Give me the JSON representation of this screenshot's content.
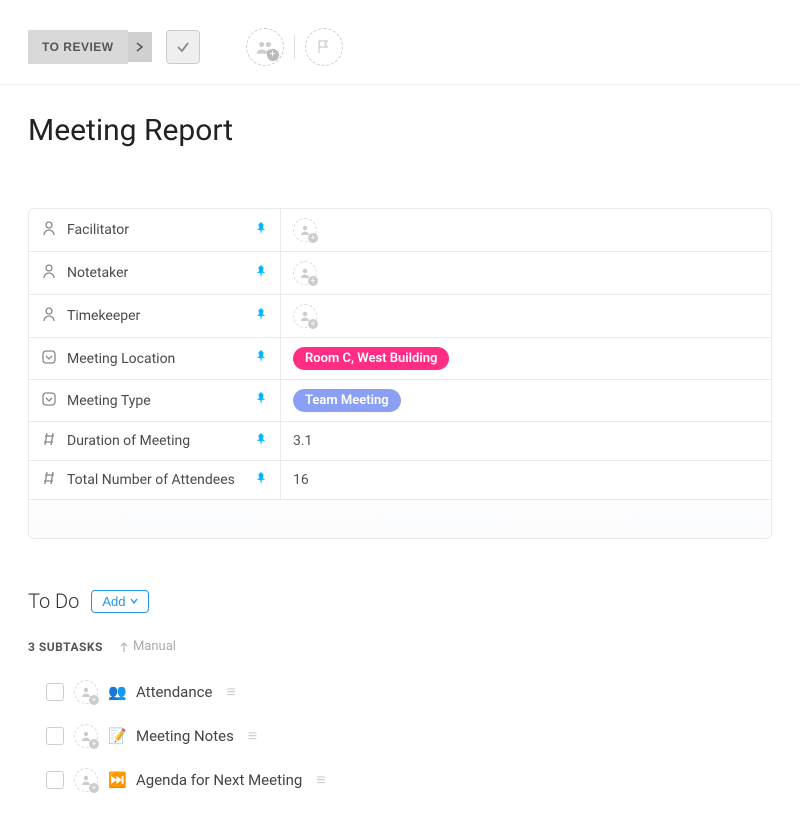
{
  "toolbar": {
    "status_label": "TO REVIEW"
  },
  "title": "Meeting Report",
  "fields": [
    {
      "icon": "person",
      "label": "Facilitator",
      "value_type": "assignee"
    },
    {
      "icon": "person",
      "label": "Notetaker",
      "value_type": "assignee"
    },
    {
      "icon": "person",
      "label": "Timekeeper",
      "value_type": "assignee"
    },
    {
      "icon": "dropdown",
      "label": "Meeting Location",
      "value_type": "pill",
      "pill_color": "pill-pink",
      "value": "Room C, West Building"
    },
    {
      "icon": "dropdown",
      "label": "Meeting Type",
      "value_type": "pill",
      "pill_color": "pill-lilac",
      "value": "Team Meeting"
    },
    {
      "icon": "number",
      "label": "Duration of Meeting",
      "value_type": "text",
      "value": "3.1"
    },
    {
      "icon": "number",
      "label": "Total Number of Attendees",
      "value_type": "text",
      "value": "16"
    }
  ],
  "todo": {
    "title": "To Do",
    "add_label": "Add"
  },
  "subtasks": {
    "count_label": "3 SUBTASKS",
    "sort_label": "Manual",
    "items": [
      {
        "emoji": "👥",
        "emoji_name": "people-icon",
        "name": "Attendance"
      },
      {
        "emoji": "📝",
        "emoji_name": "memo-icon",
        "name": "Meeting Notes"
      },
      {
        "emoji": "⏭️",
        "emoji_name": "next-track-icon",
        "name": "Agenda for Next Meeting"
      }
    ]
  }
}
